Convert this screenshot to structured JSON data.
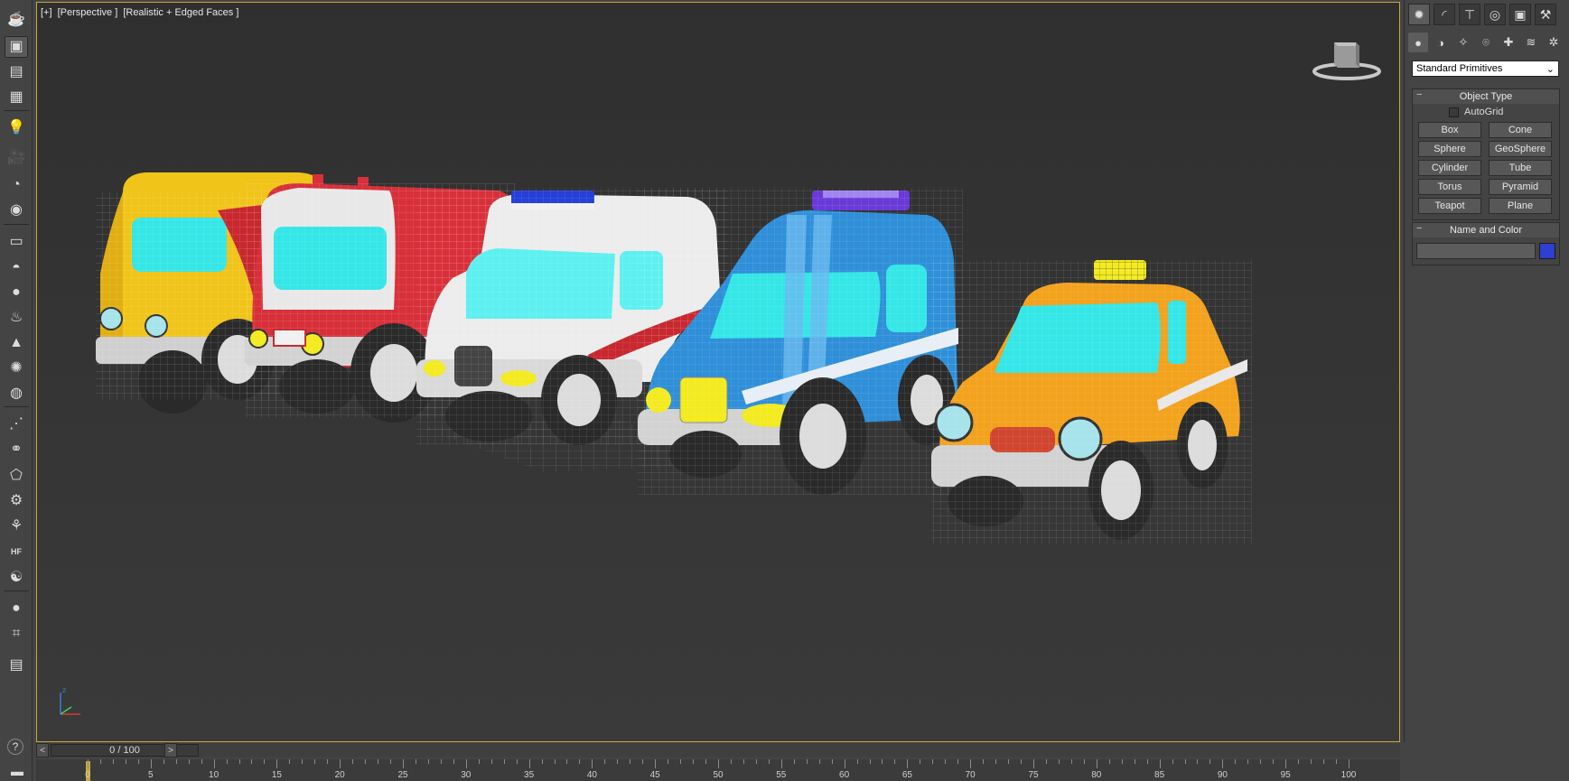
{
  "viewport": {
    "label_parts": [
      "[+]",
      "[Perspective ]",
      "[Realistic + Edged Faces ]"
    ]
  },
  "left_toolbar": [
    {
      "name": "teapot-icon",
      "glyph": "☕"
    },
    {
      "name": "render-setup-icon",
      "glyph": "▣"
    },
    {
      "name": "material-editor-icon",
      "glyph": "▤"
    },
    {
      "name": "render-frame-icon",
      "glyph": "▦"
    },
    {
      "name": "lights-icon",
      "glyph": "💡"
    },
    {
      "name": "camera-icon",
      "glyph": "🎥"
    },
    {
      "name": "render-icon",
      "glyph": "◔"
    },
    {
      "name": "render-active-icon",
      "glyph": "◉"
    },
    {
      "name": "box-primitive-icon",
      "glyph": "▭"
    },
    {
      "name": "dome-icon",
      "glyph": "◓"
    },
    {
      "name": "sphere-icon",
      "glyph": "●"
    },
    {
      "name": "teapot-primitive-icon",
      "glyph": "♨"
    },
    {
      "name": "cone-icon",
      "glyph": "▲"
    },
    {
      "name": "sun-icon",
      "glyph": "✺"
    },
    {
      "name": "sky-icon",
      "glyph": "◍"
    },
    {
      "name": "particles-icon",
      "glyph": "⋰"
    },
    {
      "name": "compound-icon",
      "glyph": "⚭"
    },
    {
      "name": "lattice-icon",
      "glyph": "⬠"
    },
    {
      "name": "gear-icon",
      "glyph": "⚙"
    },
    {
      "name": "grass-icon",
      "glyph": "⚘"
    },
    {
      "name": "hair-fur-icon",
      "glyph": "HF"
    },
    {
      "name": "shell-icon",
      "glyph": "☯"
    },
    {
      "name": "material-ball-icon",
      "glyph": "●"
    },
    {
      "name": "maxscript-icon",
      "glyph": "⌗"
    },
    {
      "name": "layers-icon",
      "glyph": "▤"
    }
  ],
  "command_panel": {
    "tabs": [
      {
        "name": "create-tab-icon",
        "glyph": "✹"
      },
      {
        "name": "modify-tab-icon",
        "glyph": "◜"
      },
      {
        "name": "hierarchy-tab-icon",
        "glyph": "⊤"
      },
      {
        "name": "motion-tab-icon",
        "glyph": "◎"
      },
      {
        "name": "display-tab-icon",
        "glyph": "▣"
      },
      {
        "name": "utilities-tab-icon",
        "glyph": "⚒"
      }
    ],
    "subtabs": [
      {
        "name": "geometry-icon",
        "glyph": "●"
      },
      {
        "name": "shapes-icon",
        "glyph": "◑"
      },
      {
        "name": "lights-subtab-icon",
        "glyph": "✧"
      },
      {
        "name": "cameras-icon",
        "glyph": "⌾"
      },
      {
        "name": "helpers-icon",
        "glyph": "✚"
      },
      {
        "name": "spacewarps-icon",
        "glyph": "≋"
      },
      {
        "name": "systems-icon",
        "glyph": "✲"
      }
    ],
    "category": "Standard Primitives",
    "object_type": {
      "title": "Object Type",
      "autogrid": "AutoGrid",
      "buttons": [
        "Box",
        "Cone",
        "Sphere",
        "GeoSphere",
        "Cylinder",
        "Tube",
        "Torus",
        "Pyramid",
        "Teapot",
        "Plane"
      ]
    },
    "name_color": {
      "title": "Name and Color",
      "color": "#2f3fd2"
    }
  },
  "timeline": {
    "frame_display": "0 / 100",
    "prev": "<",
    "next": ">",
    "ticks": [
      "0",
      "5",
      "10",
      "15",
      "20",
      "25",
      "30",
      "35",
      "40",
      "45",
      "50",
      "55",
      "60",
      "65",
      "70",
      "75",
      "80",
      "85",
      "90",
      "95",
      "100"
    ]
  },
  "bottom_icons": [
    {
      "name": "mini-listener-icon",
      "glyph": "▬"
    },
    {
      "name": "help-icon",
      "glyph": "?"
    }
  ],
  "vehicle_colors": {
    "truck_yellow": "#f0c419",
    "truck_red": "#d8303a",
    "ambulance_white": "#ececec",
    "police_blue": "#2f8fd8",
    "taxi_orange": "#f2a21d",
    "glass_cyan": "#35e6e6",
    "headlight_yellow": "#f3ea20"
  }
}
